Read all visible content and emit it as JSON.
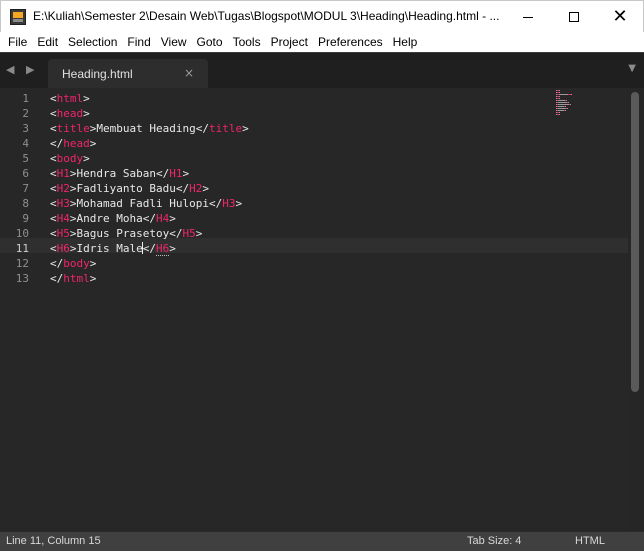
{
  "window": {
    "title": "E:\\Kuliah\\Semester 2\\Desain Web\\Tugas\\Blogspot\\MODUL 3\\Heading\\Heading.html - ...",
    "controls": {
      "minimize": "minimize",
      "maximize": "maximize",
      "close": "✕"
    }
  },
  "menu": [
    "File",
    "Edit",
    "Selection",
    "Find",
    "View",
    "Goto",
    "Tools",
    "Project",
    "Preferences",
    "Help"
  ],
  "tabbar": {
    "nav": "◀ ▶",
    "active_tab": "Heading.html",
    "close_glyph": "×",
    "dropdown_glyph": "▼"
  },
  "editor": {
    "line_numbers": [
      "1",
      "2",
      "3",
      "4",
      "5",
      "6",
      "7",
      "8",
      "9",
      "10",
      "11",
      "12",
      "13"
    ],
    "current_line": 11,
    "lines": [
      [
        [
          "br",
          "<"
        ],
        [
          "tag",
          "html"
        ],
        [
          "br",
          ">"
        ]
      ],
      [
        [
          "br",
          "<"
        ],
        [
          "tag",
          "head"
        ],
        [
          "br",
          ">"
        ]
      ],
      [
        [
          "br",
          "<"
        ],
        [
          "tag",
          "title"
        ],
        [
          "br",
          ">"
        ],
        [
          "txt",
          "Membuat Heading"
        ],
        [
          "br",
          "</"
        ],
        [
          "tag",
          "title"
        ],
        [
          "br",
          ">"
        ]
      ],
      [
        [
          "br",
          "</"
        ],
        [
          "tag",
          "head"
        ],
        [
          "br",
          ">"
        ]
      ],
      [
        [
          "br",
          "<"
        ],
        [
          "tag",
          "body"
        ],
        [
          "br",
          ">"
        ]
      ],
      [
        [
          "br",
          "<"
        ],
        [
          "tag",
          "H1"
        ],
        [
          "br",
          ">"
        ],
        [
          "txt",
          "Hendra Saban"
        ],
        [
          "br",
          "</"
        ],
        [
          "tag",
          "H1"
        ],
        [
          "br",
          ">"
        ]
      ],
      [
        [
          "br",
          "<"
        ],
        [
          "tag",
          "H2"
        ],
        [
          "br",
          ">"
        ],
        [
          "txt",
          "Fadliyanto Badu"
        ],
        [
          "br",
          "</"
        ],
        [
          "tag",
          "H2"
        ],
        [
          "br",
          ">"
        ]
      ],
      [
        [
          "br",
          "<"
        ],
        [
          "tag",
          "H3"
        ],
        [
          "br",
          ">"
        ],
        [
          "txt",
          "Mohamad Fadli Hulopi"
        ],
        [
          "br",
          "</"
        ],
        [
          "tag",
          "H3"
        ],
        [
          "br",
          ">"
        ]
      ],
      [
        [
          "br",
          "<"
        ],
        [
          "tag",
          "H4"
        ],
        [
          "br",
          ">"
        ],
        [
          "txt",
          "Andre Moha"
        ],
        [
          "br",
          "</"
        ],
        [
          "tag",
          "H4"
        ],
        [
          "br",
          ">"
        ]
      ],
      [
        [
          "br",
          "<"
        ],
        [
          "tag",
          "H5"
        ],
        [
          "br",
          ">"
        ],
        [
          "txt",
          "Bagus Prasetoy"
        ],
        [
          "br",
          "</"
        ],
        [
          "tag",
          "H5"
        ],
        [
          "br",
          ">"
        ]
      ],
      [
        [
          "br",
          "<"
        ],
        [
          "tag",
          "H6"
        ],
        [
          "br",
          ">"
        ],
        [
          "txt",
          "Idris Male"
        ],
        [
          "caret",
          ""
        ],
        [
          "br",
          "</"
        ],
        [
          "tagdot",
          "H6"
        ],
        [
          "br",
          ">"
        ]
      ],
      [
        [
          "br",
          "</"
        ],
        [
          "tag",
          "body"
        ],
        [
          "br",
          ">"
        ]
      ],
      [
        [
          "br",
          "</"
        ],
        [
          "tag",
          "html"
        ],
        [
          "br",
          ">"
        ]
      ]
    ],
    "colors": {
      "background": "#272727",
      "tag": "#f0246d",
      "text": "#e8e8e8"
    }
  },
  "status": {
    "position": "Line 11, Column 15",
    "tab_size": "Tab Size: 4",
    "syntax": "HTML"
  }
}
